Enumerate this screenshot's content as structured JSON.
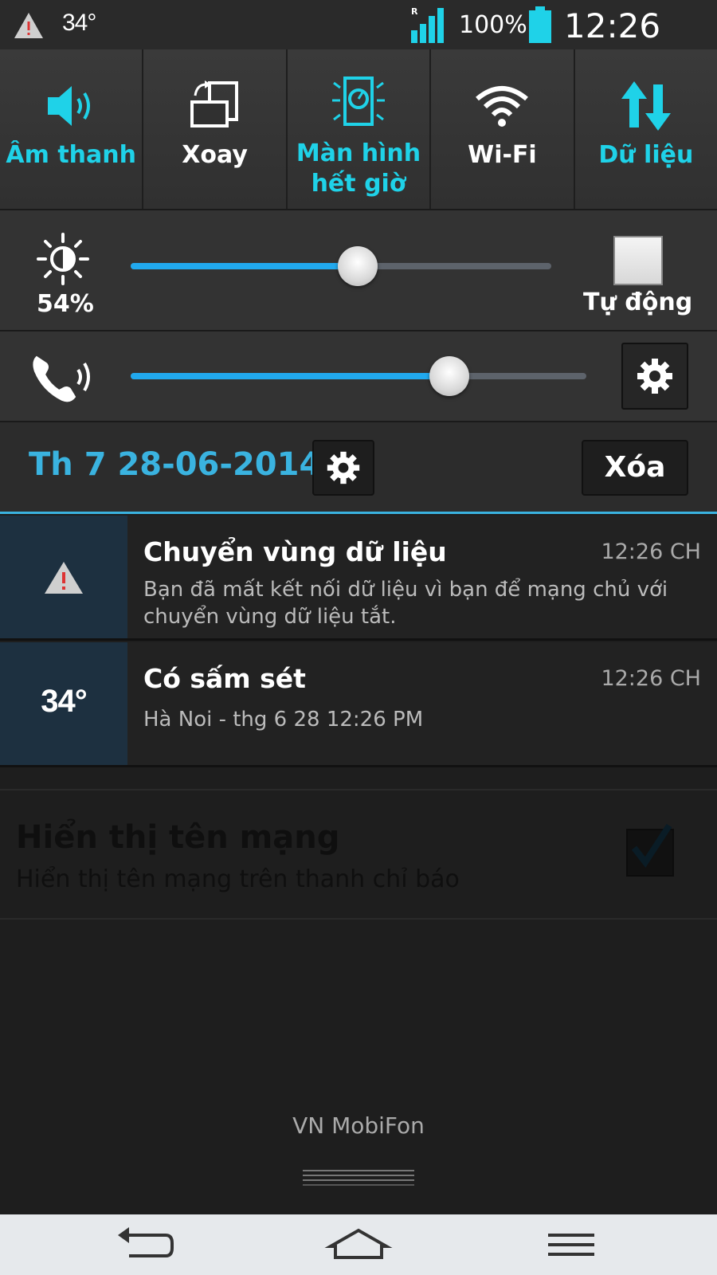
{
  "status_bar": {
    "temperature": "34°",
    "roaming_indicator": "R",
    "battery_percent": "100%",
    "time": "12:26 CH"
  },
  "quick_settings": [
    {
      "label": "Âm thanh",
      "icon": "speaker-icon",
      "active": true
    },
    {
      "label": "Xoay",
      "icon": "rotate-icon",
      "active": false
    },
    {
      "label": "Màn hình hết giờ",
      "icon": "screen-timeout-icon",
      "active": true
    },
    {
      "label": "Wi-Fi",
      "icon": "wifi-icon",
      "active": false
    },
    {
      "label": "Dữ liệu",
      "icon": "data-icon",
      "active": true
    }
  ],
  "brightness": {
    "percent_label": "54%",
    "level": 0.54,
    "auto_label": "Tự động"
  },
  "volume": {
    "level": 0.7
  },
  "date_row": {
    "date": "Th 7 28-06-2014",
    "clear_label": "Xóa"
  },
  "notifications": [
    {
      "title": "Chuyển vùng dữ liệu",
      "time": "12:26 CH",
      "text": "Bạn đã mất kết nối dữ liệu vì bạn để mạng chủ với chuyển vùng dữ liệu tắt.",
      "icon": "warning-icon"
    },
    {
      "title": " Có sấm sét",
      "time": "12:26 CH",
      "text": "Hà Noi - thg 6 28  12:26 PM",
      "icon_text": "34°"
    }
  ],
  "background_setting": {
    "title": "Hiển thị tên mạng",
    "subtitle": "Hiển thị tên mạng trên thanh chỉ báo"
  },
  "carrier": "VN MobiFon",
  "colors": {
    "accent": "#1fd2e8",
    "slider": "#21a9ee",
    "date": "#3ab3e0"
  }
}
